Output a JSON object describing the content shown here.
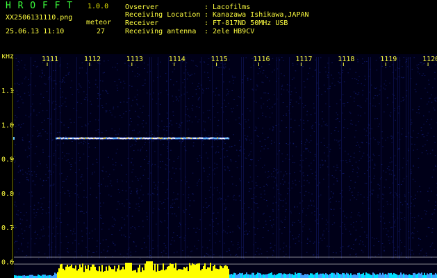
{
  "header": {
    "app_name": "H R O F F T",
    "version": "1.0.0",
    "filename": "XX2506131110.png",
    "datetime": "25.06.13 11:10",
    "meteor_label": "meteor",
    "meteor_count": "27"
  },
  "station": [
    {
      "label": "Ovserver",
      "value": ": Lacofilms"
    },
    {
      "label": "Receiving Location",
      "value": ": Kanazawa Ishikawa,JAPAN"
    },
    {
      "label": "Receiver",
      "value": ": FT-817ND 50MHz USB"
    },
    {
      "label": "Receiving antenna",
      "value": ": 2ele HB9CV"
    }
  ],
  "chart_data": {
    "type": "heatmap",
    "ylabel": "kHz",
    "x_ticks": [
      "1111",
      "1112",
      "1113",
      "1114",
      "1115",
      "1116",
      "1117",
      "1118",
      "1119",
      "1120"
    ],
    "y_ticks": [
      "1.1",
      "1.0",
      "0.9",
      "0.8",
      "0.7",
      "0.6"
    ],
    "ylim": [
      0.58,
      1.17
    ],
    "xlim": [
      1110.5,
      1120.2
    ],
    "colors": {
      "background": "#000020",
      "noise": "#1a2aa0",
      "echo": "#ffffff",
      "echo_edge": "#ffe040",
      "hist_yellow": "#ffff00",
      "hist_cyan": "#00e0ff",
      "grid": "#2a2a5a",
      "marker": "#ffffff"
    },
    "echo_trace": {
      "x_start": 1111.2,
      "x_end": 1115.3,
      "khz": 0.96
    },
    "reference_lines_khz": [
      0.62,
      0.6
    ]
  }
}
